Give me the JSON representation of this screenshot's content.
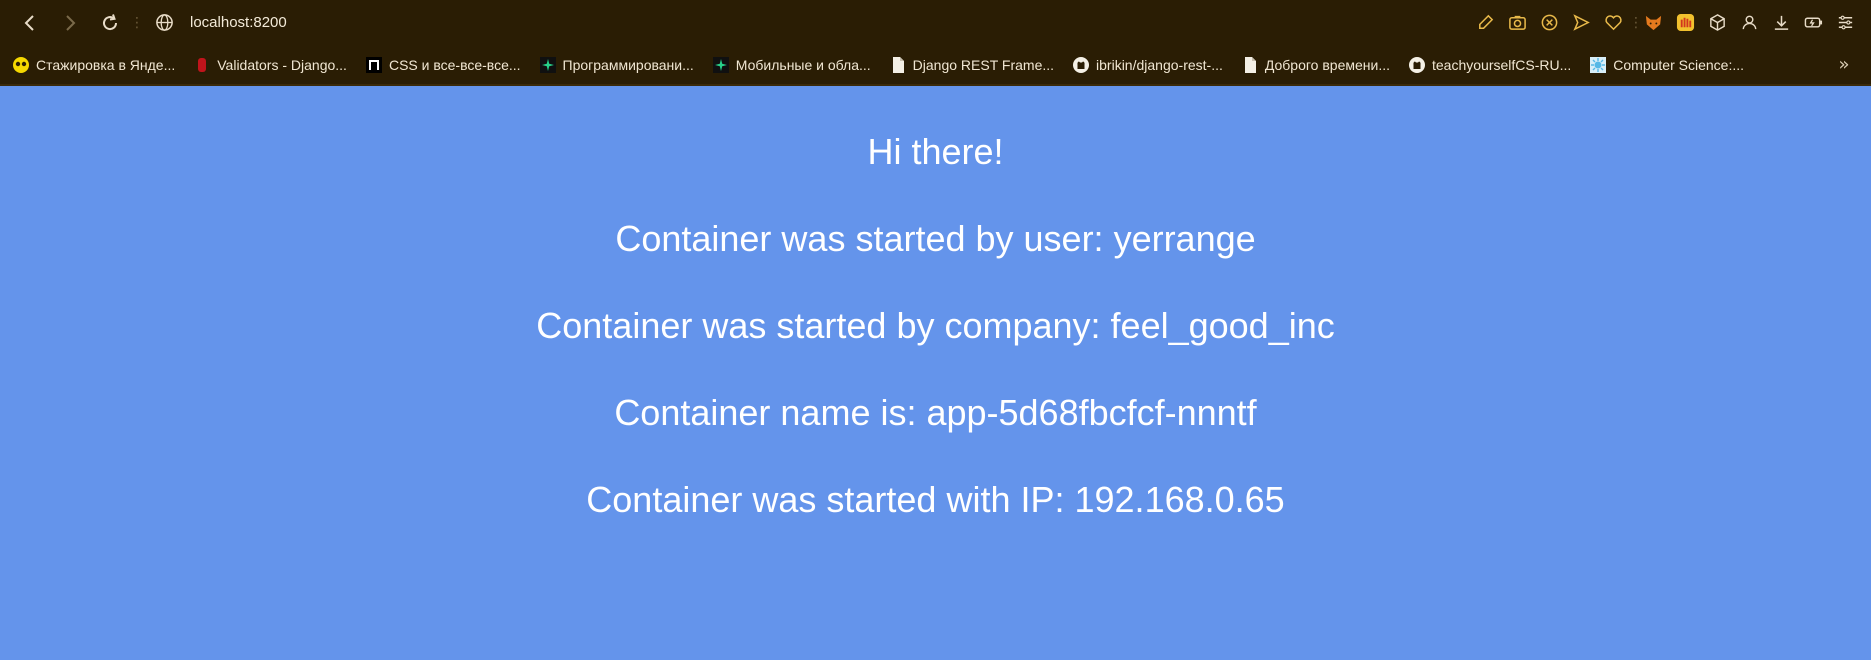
{
  "browser": {
    "url": "localhost:8200",
    "toolbar_icons": [
      "edit-icon",
      "camera-icon",
      "close-circle-icon",
      "send-icon",
      "heart-icon",
      "fox-extension-icon",
      "hand-extension-icon",
      "cube-icon",
      "profile-icon",
      "download-icon",
      "battery-icon",
      "menu-icon"
    ]
  },
  "bookmarks": [
    {
      "label": "Стажировка в Янде...",
      "icon": "yandex-icon",
      "color": "#f5d800"
    },
    {
      "label": "Validators - Django...",
      "icon": "django-icon",
      "color": "#c0141b"
    },
    {
      "label": "CSS и все-все-все...",
      "icon": "css-icon",
      "color": "#000000"
    },
    {
      "label": "Программировани...",
      "icon": "star-icon",
      "color": "#28d28a"
    },
    {
      "label": "Мобильные и обла...",
      "icon": "star-icon",
      "color": "#28d28a"
    },
    {
      "label": "Django REST Frame...",
      "icon": "document-icon",
      "color": "#ffffff"
    },
    {
      "label": "ibrikin/django-rest-...",
      "icon": "github-icon",
      "color": "#ffffff"
    },
    {
      "label": "Доброго времени...",
      "icon": "document-icon",
      "color": "#ffffff"
    },
    {
      "label": "teachyourselfCS-RU...",
      "icon": "github-icon",
      "color": "#ffffff"
    },
    {
      "label": "Computer Science:...",
      "icon": "sun-icon",
      "color": "#56b8e6"
    }
  ],
  "page": {
    "greeting": "Hi there!",
    "user_line": "Container was started by user: yerrange",
    "company_line": "Container was started by company: feel_good_inc",
    "name_line": "Container name is: app-5d68fbcfcf-nnntf",
    "ip_line": "Container was started with IP: 192.168.0.65",
    "background": "#6494eb"
  }
}
